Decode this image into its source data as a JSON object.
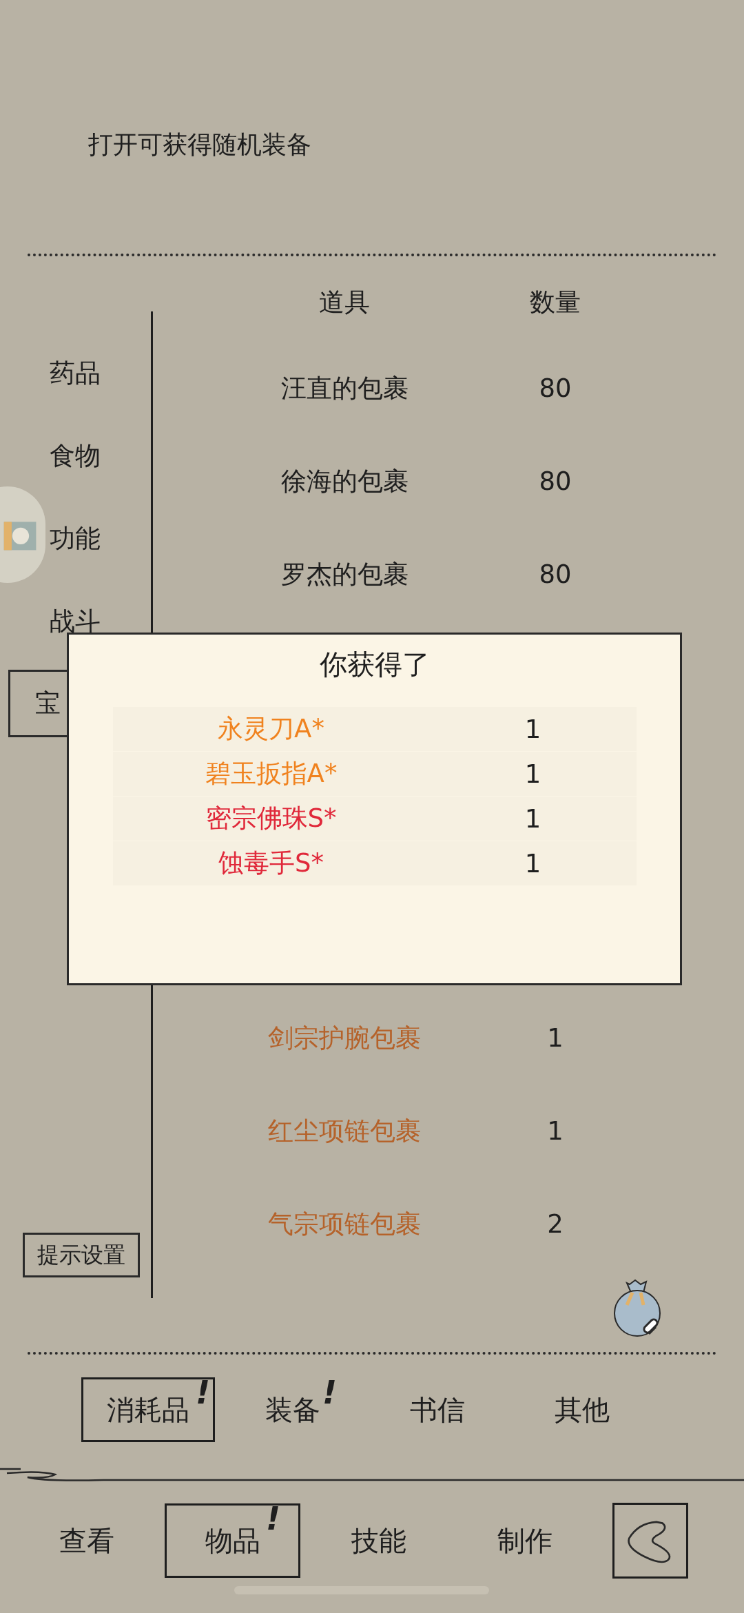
{
  "description": "打开可获得随机装备",
  "sidebar": {
    "items": [
      {
        "label": "药品",
        "selected": false
      },
      {
        "label": "食物",
        "selected": false
      },
      {
        "label": "功能",
        "selected": false
      },
      {
        "label": "战斗",
        "selected": false
      },
      {
        "label": "宝",
        "selected": true
      }
    ],
    "settings_button": "提示设置"
  },
  "table": {
    "columns": [
      "道具",
      "数量"
    ],
    "rows_before": [
      {
        "name": "汪直的包裹",
        "count": "80",
        "color": "#1e1e1e"
      },
      {
        "name": "徐海的包裹",
        "count": "80",
        "color": "#1e1e1e"
      },
      {
        "name": "罗杰的包裹",
        "count": "80",
        "color": "#1e1e1e"
      }
    ],
    "rows_after": [
      {
        "name": "剑宗护腕包裹",
        "count": "1",
        "color": "#b5622a"
      },
      {
        "name": "红尘项链包裹",
        "count": "1",
        "color": "#b5622a"
      },
      {
        "name": "气宗项链包裹",
        "count": "2",
        "color": "#b5622a"
      }
    ]
  },
  "dialog": {
    "title": "你获得了",
    "items": [
      {
        "name": "永灵刀A*",
        "count": "1",
        "color": "#f0821e"
      },
      {
        "name": "碧玉扳指A*",
        "count": "1",
        "color": "#f0821e"
      },
      {
        "name": "密宗佛珠S*",
        "count": "1",
        "color": "#e0283a"
      },
      {
        "name": "蚀毒手S*",
        "count": "1",
        "color": "#e0283a"
      }
    ]
  },
  "category_tabs": [
    {
      "label": "消耗品",
      "selected": true,
      "alert": "!"
    },
    {
      "label": "装备",
      "selected": false,
      "alert": "!"
    },
    {
      "label": "书信",
      "selected": false
    },
    {
      "label": "其他",
      "selected": false
    }
  ],
  "nav_tabs": [
    {
      "label": "查看",
      "selected": false
    },
    {
      "label": "物品",
      "selected": true,
      "alert": "!"
    },
    {
      "label": "技能",
      "selected": false
    },
    {
      "label": "制作",
      "selected": false
    }
  ]
}
